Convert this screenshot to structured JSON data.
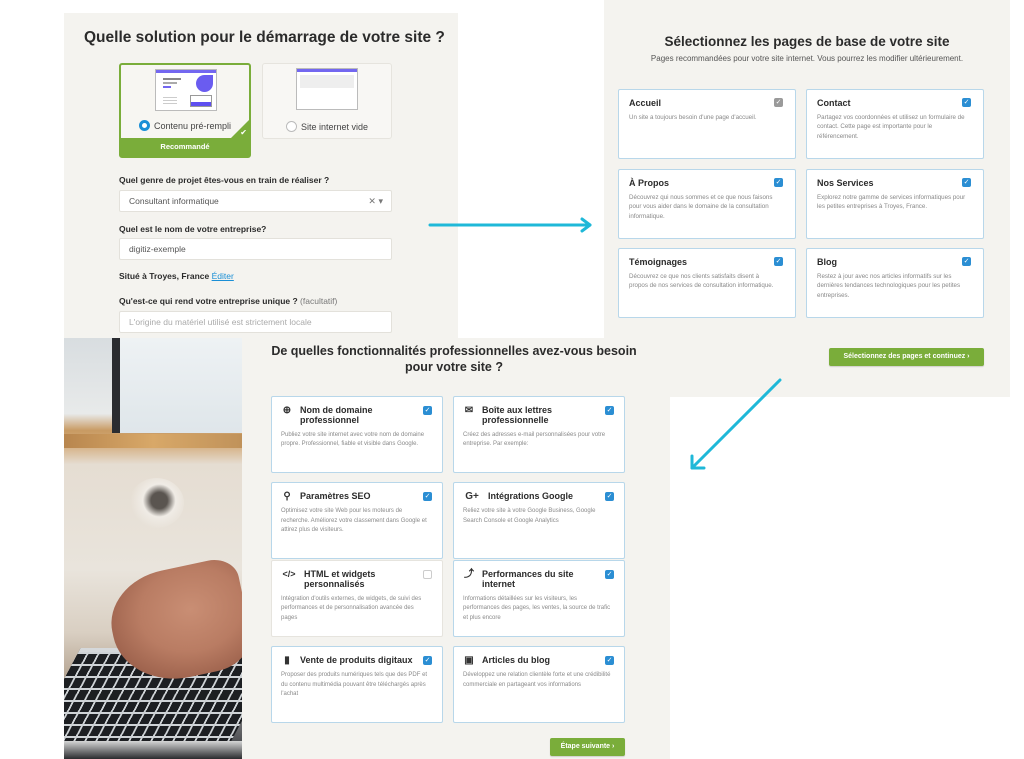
{
  "panel1": {
    "title": "Quelle solution pour le démarrage de votre site ?",
    "options": [
      {
        "label": "Contenu pré-rempli",
        "selected": true,
        "badge": "Recommandé"
      },
      {
        "label": "Site internet vide",
        "selected": false
      }
    ],
    "project_label": "Quel genre de projet êtes-vous en train de réaliser ?",
    "project_value": "Consultant informatique",
    "project_clear": "✕",
    "project_caret": "▾",
    "company_label": "Quel est le nom de votre entreprise?",
    "company_value": "digitiz-exemple",
    "location_text": "Situé à Troyes, France",
    "location_edit": "Éditer",
    "unique_label": "Qu'est-ce qui rend votre entreprise unique ?",
    "unique_optional": "(facultatif)",
    "unique_placeholder": "L'origine du matériel utilisé est strictement locale"
  },
  "panel2": {
    "title": "Sélectionnez les pages de base de votre site",
    "subtitle": "Pages recommandées pour votre site internet. Vous pourrez les modifier ultérieurement.",
    "pages": [
      {
        "title": "Accueil",
        "desc": "Un site a toujours besoin d'une page d'accueil.",
        "checked": true,
        "locked": true
      },
      {
        "title": "Contact",
        "desc": "Partagez vos coordonnées et utilisez un formulaire de contact. Cette page est importante pour le référencement.",
        "checked": true
      },
      {
        "title": "À Propos",
        "desc": "Découvrez qui nous sommes et ce que nous faisons pour vous aider dans le domaine de la consultation informatique.",
        "checked": true
      },
      {
        "title": "Nos Services",
        "desc": "Explorez notre gamme de services informatiques pour les petites entreprises à Troyes, France.",
        "checked": true
      },
      {
        "title": "Témoignages",
        "desc": "Découvrez ce que nos clients satisfaits disent à propos de nos services de consultation informatique.",
        "checked": true
      },
      {
        "title": "Blog",
        "desc": "Restez à jour avec nos articles informatifs sur les dernières tendances technologiques pour les petites entreprises.",
        "checked": true
      }
    ],
    "continue_button": "Sélectionnez des pages et continuez ›"
  },
  "panel3": {
    "title": "De quelles fonctionnalités professionnelles avez-vous besoin pour votre site ?",
    "features": [
      {
        "icon": "globe-icon",
        "glyph": "🌐",
        "title": "Nom de domaine professionnel",
        "desc": "Publiez votre site internet avec votre nom de domaine propre. Professionnel, fiable et visible dans Google.",
        "checked": true
      },
      {
        "icon": "mail-icon",
        "glyph": "✉",
        "title": "Boîte aux lettres professionnelle",
        "desc": "Créez des adresses e-mail personnalisées pour votre entreprise. Par exemple:",
        "checked": true
      },
      {
        "icon": "search-icon",
        "glyph": "🔍",
        "title": "Paramètres SEO",
        "desc": "Optimisez votre site Web pour les moteurs de recherche. Améliorez votre classement dans Google et attirez plus de visiteurs.",
        "checked": true
      },
      {
        "icon": "google-plus-icon",
        "glyph": "G+",
        "title": "Intégrations Google",
        "desc": "Reliez votre site à votre Google Business, Google Search Console et Google Analytics",
        "checked": true
      },
      {
        "icon": "code-icon",
        "glyph": "</>",
        "title": "HTML et widgets personnalisés",
        "desc": "Intégration d'outils externes, de widgets, de suivi des performances et de personnalisation avancée des pages",
        "checked": false
      },
      {
        "icon": "chart-trend-icon",
        "glyph": "📈",
        "title": "Performances du site internet",
        "desc": "Informations détaillées sur les visiteurs, les performances des pages, les ventes, la source de trafic et plus encore",
        "checked": true
      },
      {
        "icon": "digital-product-icon",
        "glyph": "🗎",
        "title": "Vente de produits digitaux",
        "desc": "Proposer des produits numériques tels que des PDF et du contenu multimédia pouvant être téléchargés après l'achat",
        "checked": true
      },
      {
        "icon": "calendar-icon",
        "glyph": "📅",
        "title": "Articles du blog",
        "desc": "Développez une relation clientèle forte et une crédibilité commerciale en partageant vos informations",
        "checked": true
      }
    ],
    "next_button": "Étape suivante ›"
  },
  "colors": {
    "panel_bg": "#f4f3ef",
    "accent_green": "#7aad3a",
    "checkbox_blue": "#2b8ed3",
    "arrow_cyan": "#1fb8d8",
    "card_border": "#b8d7ea"
  }
}
